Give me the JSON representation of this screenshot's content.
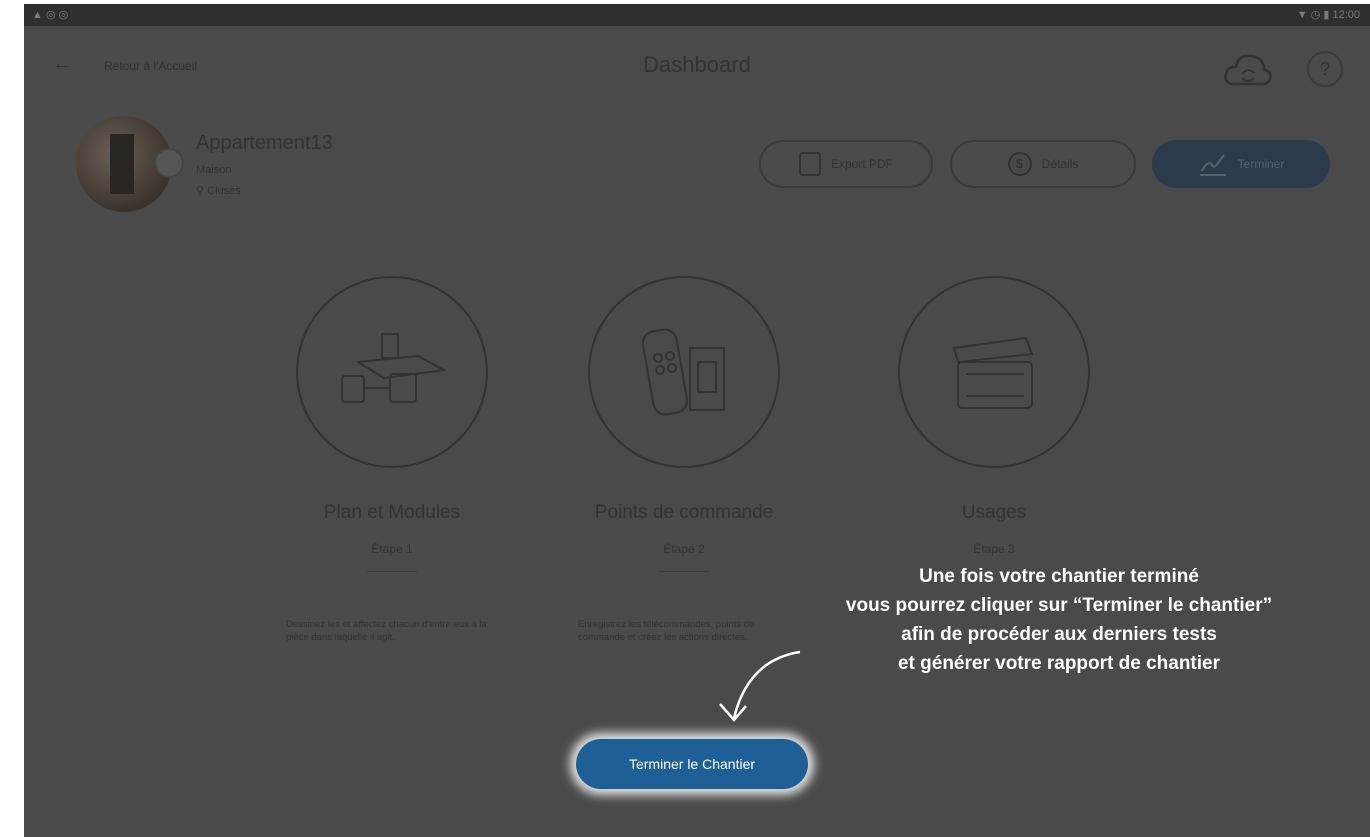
{
  "statusbar": {
    "left": "▲ ◎ ◎",
    "right": "▼ ◷ ▮ 12:00"
  },
  "header": {
    "back_label": "Retour à l'Accueil",
    "title": "Dashboard",
    "help_label": "?"
  },
  "project": {
    "name": "Appartement13",
    "type": "Maison",
    "location": "Cluses"
  },
  "actions": {
    "export_label": "Export PDF",
    "details_label": "Détails",
    "details_icon": "$",
    "finish_label": "Terminer"
  },
  "steps": [
    {
      "title": "Plan et Modules",
      "subtitle": "Étape 1",
      "description": "Dessinez les et affectez chacun d'entre eux à la pièce dans laquelle il agit."
    },
    {
      "title": "Points de commande",
      "subtitle": "Étape 2",
      "description": "Enregistrez les télécommandes, points de commande et créez les actions directes."
    },
    {
      "title": "Usages",
      "subtitle": "Étape 3",
      "description": ""
    }
  ],
  "callout": {
    "lines": [
      "Une fois votre chantier terminé",
      "vous pourrez cliquer sur “Terminer le chantier”",
      "afin de procéder aux derniers tests",
      "et générer votre rapport de chantier"
    ]
  },
  "cta": {
    "label": "Terminer le Chantier"
  },
  "colors": {
    "overlay": "#4a4a4a",
    "cta": "#1e5f95",
    "finish_pill": "#2c3b4b",
    "callout_text": "#ffffff"
  },
  "icons": [
    "back-arrow-icon",
    "cloud-sync-icon",
    "help-icon",
    "pdf-icon",
    "info-icon",
    "sign-icon",
    "modules-icon",
    "remote-icon",
    "window-icon",
    "curved-arrow-icon"
  ]
}
